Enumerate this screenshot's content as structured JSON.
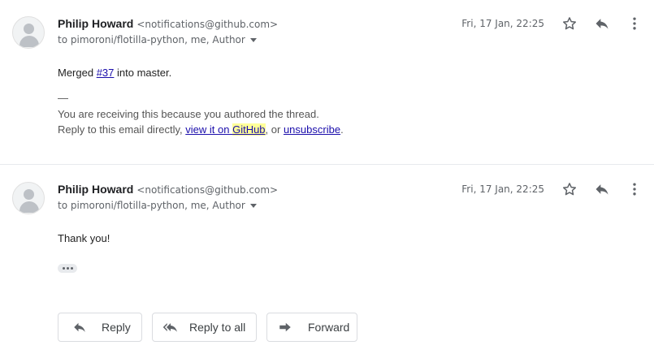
{
  "messages": [
    {
      "sender_name": "Philip Howard",
      "sender_email": "<notifications@github.com>",
      "recipients": "to pimoroni/flotilla-python, me, Author",
      "date": "Fri, 17 Jan, 22:25",
      "body": {
        "prefix": "Merged ",
        "link": "#37",
        "suffix": " into master.",
        "divider": "—",
        "footer_line1": "You are receiving this because you authored the thread.",
        "footer_line2_prefix": "Reply to this email directly, ",
        "view_link_a": "view it on ",
        "view_link_b": "GitHub",
        "footer_line2_mid": ", or ",
        "unsubscribe_link": "unsubscribe",
        "footer_line2_end": "."
      }
    },
    {
      "sender_name": "Philip Howard",
      "sender_email": "<notifications@github.com>",
      "recipients": "to pimoroni/flotilla-python, me, Author",
      "date": "Fri, 17 Jan, 22:25",
      "body": {
        "text": "Thank you!"
      }
    }
  ],
  "actions": {
    "reply": "Reply",
    "reply_all": "Reply to all",
    "forward": "Forward"
  },
  "icons": [
    "avatar-icon",
    "star-icon",
    "reply-icon",
    "more-vert-icon",
    "reply-all-icon",
    "forward-icon",
    "ellipsis-icon"
  ],
  "colors": {
    "link": "#1a0dab",
    "highlight": "#ffff99",
    "icon": "#5f6368"
  }
}
